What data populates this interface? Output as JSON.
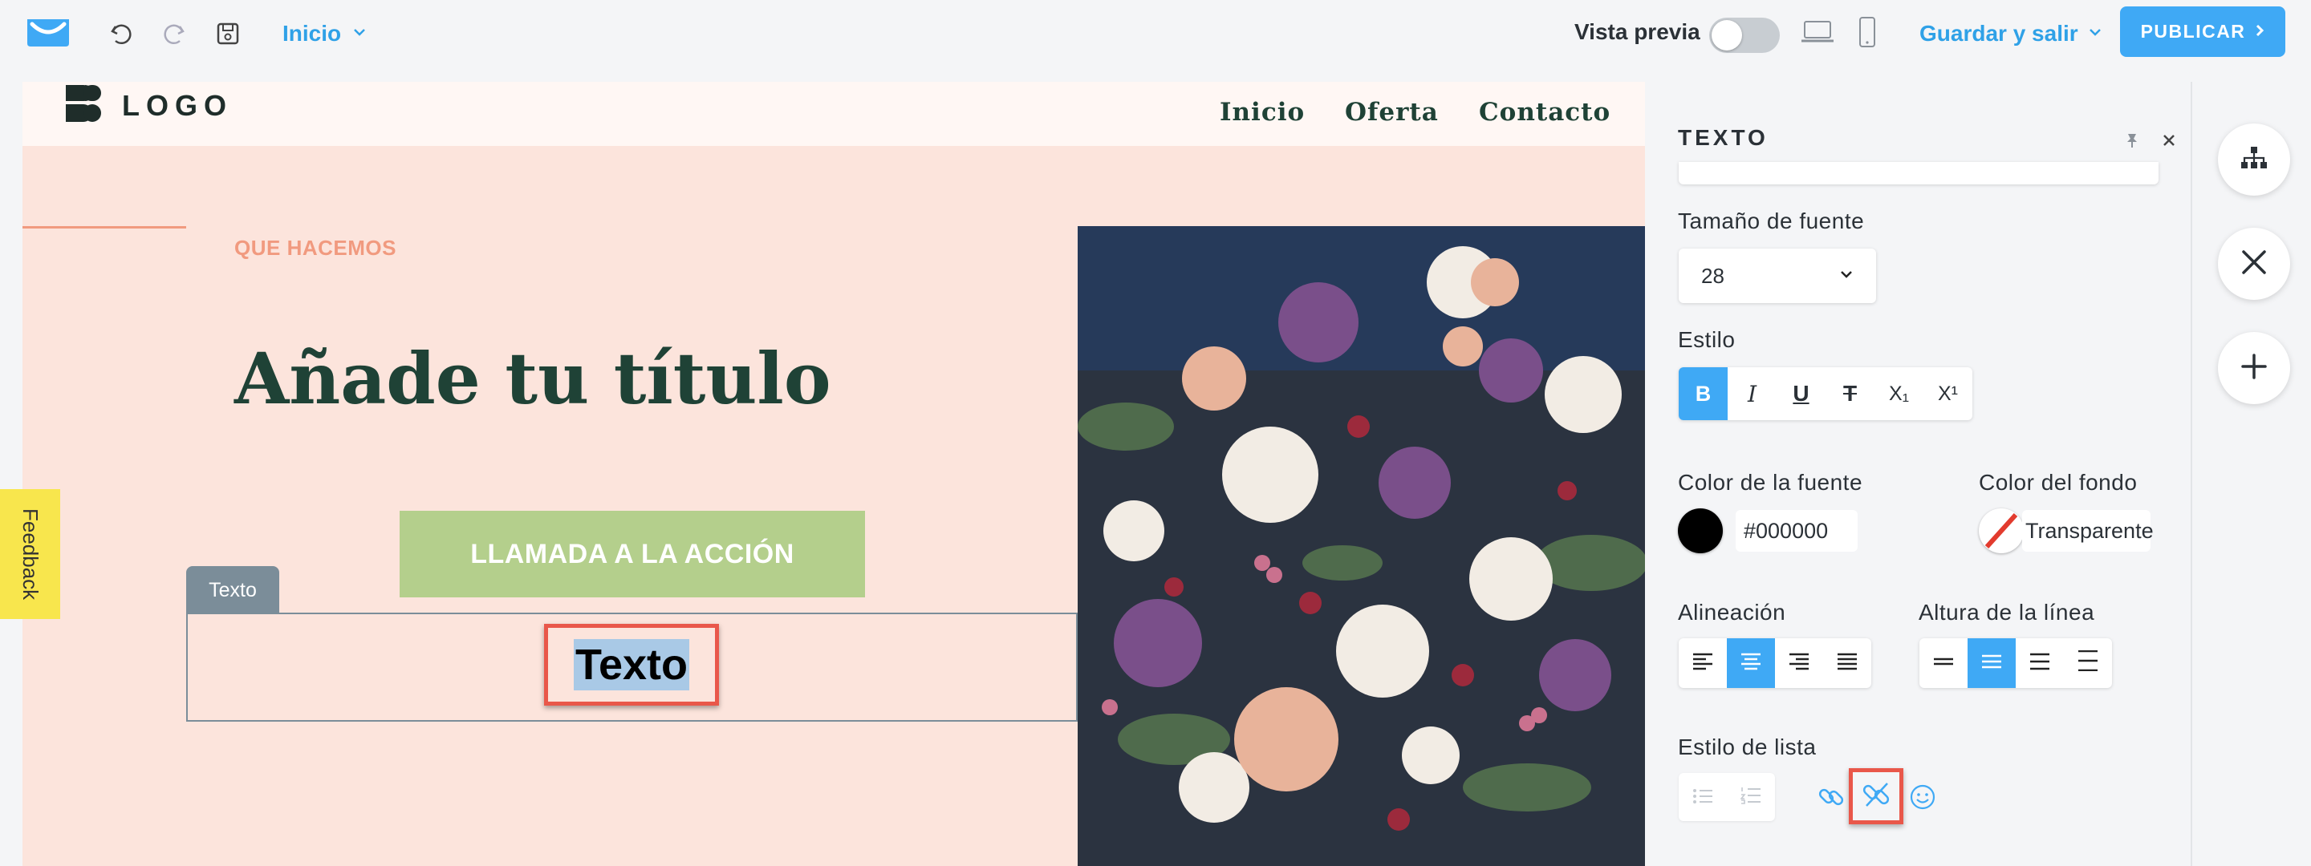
{
  "topbar": {
    "page_select": "Inicio",
    "preview_label": "Vista previa",
    "save_exit": "Guardar y salir",
    "publish": "PUBLICAR"
  },
  "site": {
    "logo": "LOGO",
    "nav": [
      "Inicio",
      "Oferta",
      "Contacto"
    ],
    "eyebrow": "QUE HACEMOS",
    "title": "Añade tu título",
    "cta": "LLAMADA A LA ACCIÓN",
    "text_tag": "Texto",
    "text_selected": "Texto"
  },
  "panel": {
    "title": "TEXTO",
    "font_size_label": "Tamaño de fuente",
    "font_size_value": "28",
    "style_label": "Estilo",
    "style_buttons": [
      "B",
      "I",
      "U",
      "T",
      "X₁",
      "X¹"
    ],
    "font_color_label": "Color de la fuente",
    "font_color_value": "#000000",
    "bg_color_label": "Color del fondo",
    "bg_color_value": "Transparente",
    "align_label": "Alineación",
    "line_height_label": "Altura de la línea",
    "list_style_label": "Estilo de lista"
  },
  "feedback": "Feedback",
  "colors": {
    "accent": "#3fa9f5",
    "canvas_bg": "#fce4dc",
    "cta_bg": "#b4cf8c",
    "title": "#1f4236",
    "highlight": "#e9574a"
  }
}
